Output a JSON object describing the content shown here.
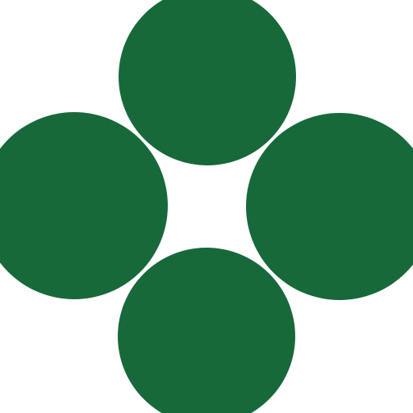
{
  "colors": {
    "background": "#ffffff",
    "circle_fill": "#17693a"
  },
  "icon": {
    "name": "four-circle-clover-icon"
  }
}
